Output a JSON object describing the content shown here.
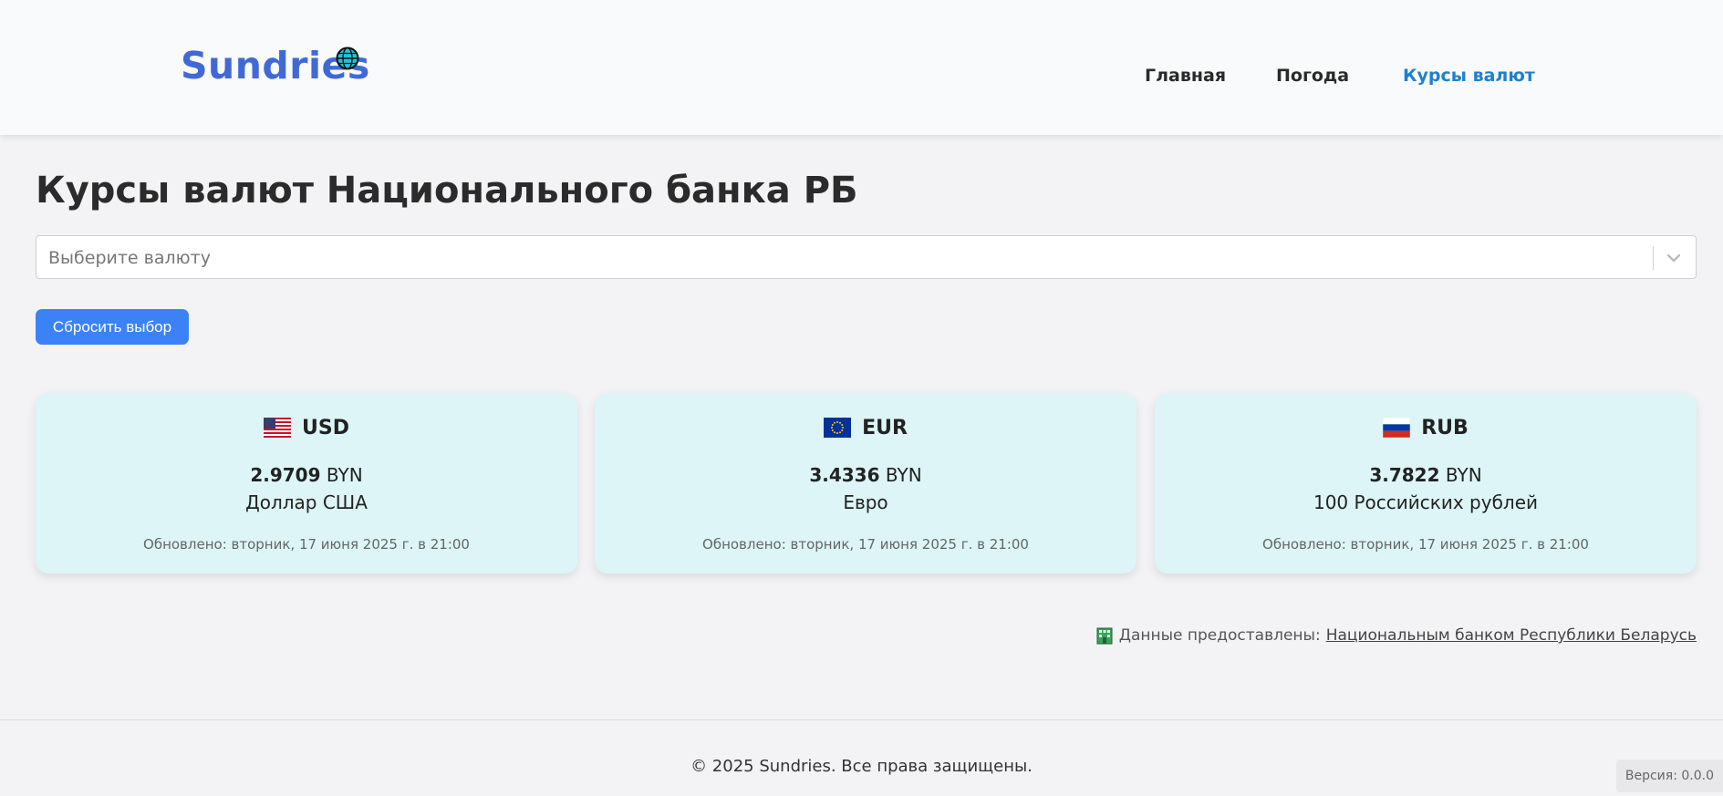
{
  "header": {
    "logo_text": "Sundries",
    "nav": [
      {
        "label": "Главная",
        "active": false
      },
      {
        "label": "Погода",
        "active": false
      },
      {
        "label": "Курсы валют",
        "active": true
      }
    ]
  },
  "main": {
    "title": "Курсы валют Национального банка РБ",
    "select": {
      "placeholder": "Выберите валюту"
    },
    "reset_button": "Сбросить выбор",
    "cards": [
      {
        "flag": "us-flag-icon",
        "code": "USD",
        "rate": "2.9709",
        "unit": "BYN",
        "name": "Доллар США",
        "updated": "Обновлено: вторник, 17 июня 2025 г. в 21:00"
      },
      {
        "flag": "eu-flag-icon",
        "code": "EUR",
        "rate": "3.4336",
        "unit": "BYN",
        "name": "Евро",
        "updated": "Обновлено: вторник, 17 июня 2025 г. в 21:00"
      },
      {
        "flag": "ru-flag-icon",
        "code": "RUB",
        "rate": "3.7822",
        "unit": "BYN",
        "name": "100 Российских рублей",
        "updated": "Обновлено: вторник, 17 июня 2025 г. в 21:00"
      }
    ],
    "source": {
      "prefix": "Данные предоставлены:",
      "link": "Национальным банком Республики Беларусь"
    }
  },
  "footer": {
    "copyright": "© 2025 Sundries. Все права защищены.",
    "version": "Версия: 0.0.0"
  },
  "colors": {
    "accent": "#3b82f6",
    "logo": "#4169d6",
    "nav_active": "#1e7fd1",
    "card_bg": "#ddf5f6"
  }
}
